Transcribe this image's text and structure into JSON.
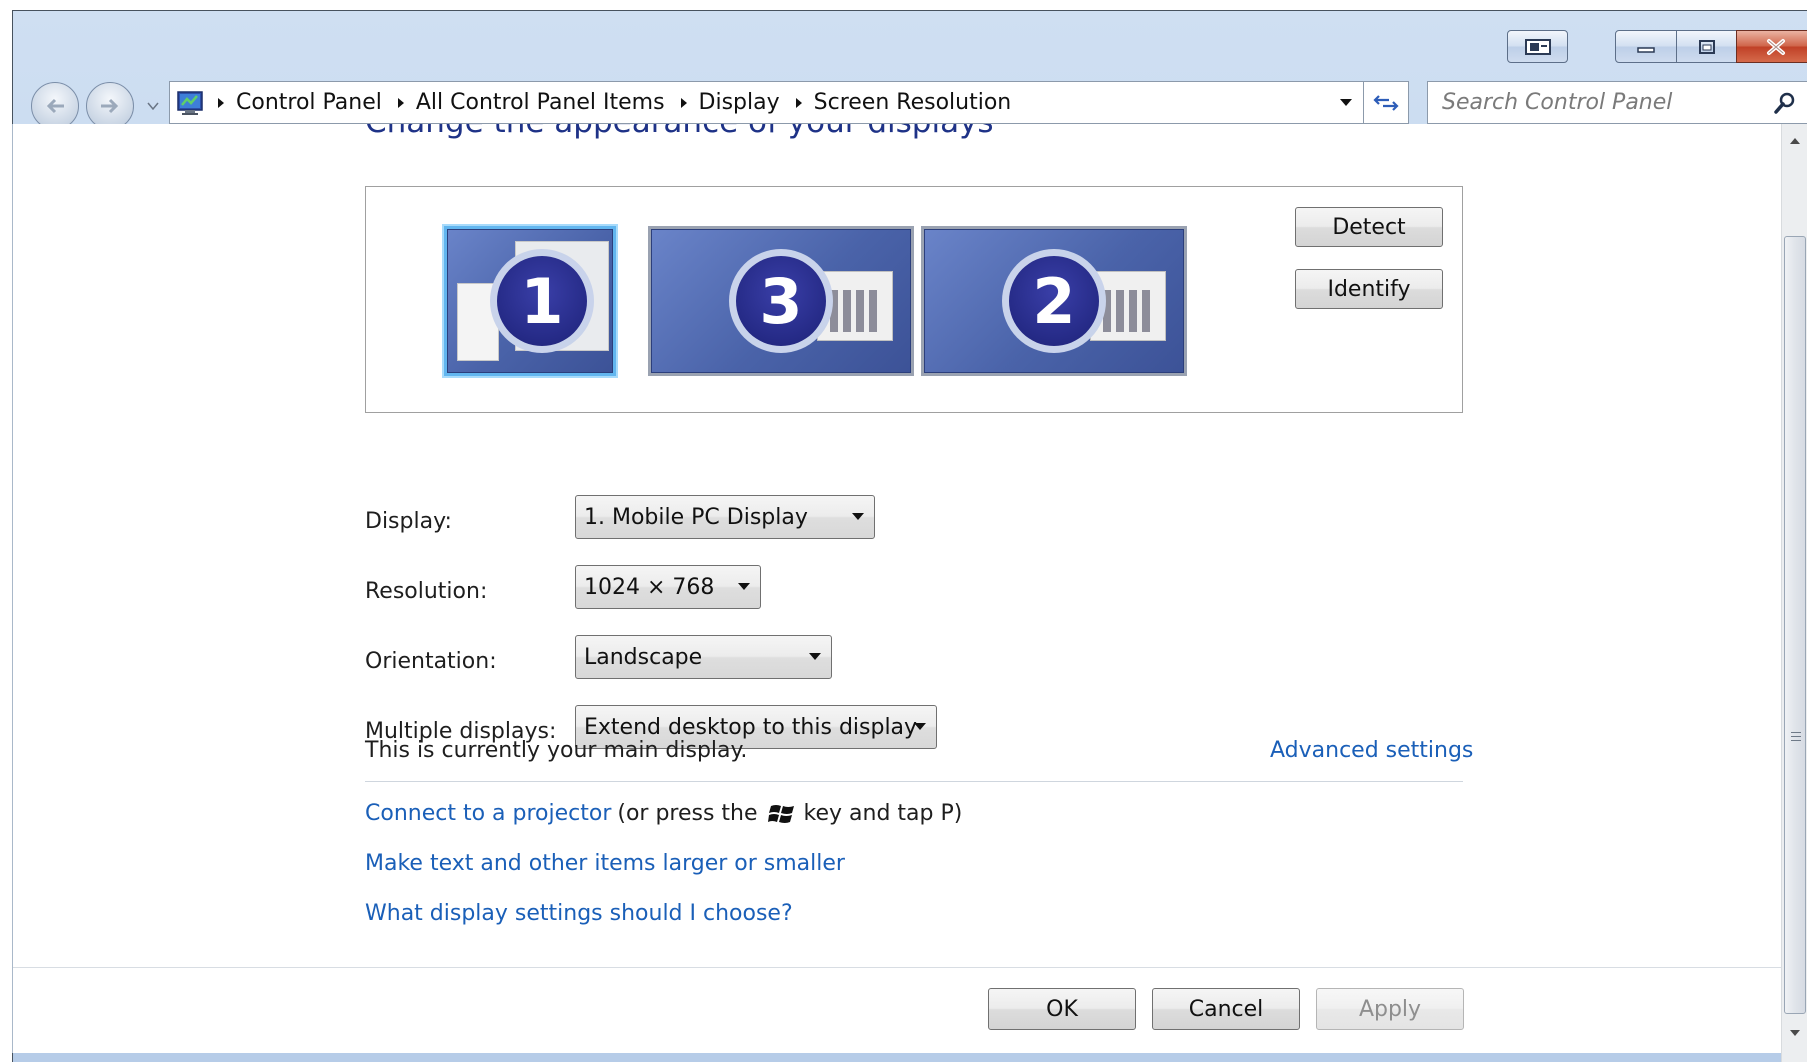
{
  "window": {
    "title": "Screen Resolution"
  },
  "address_bar": {
    "breadcrumbs": [
      "Control Panel",
      "All Control Panel Items",
      "Display",
      "Screen Resolution"
    ]
  },
  "search": {
    "placeholder": "Search Control Panel"
  },
  "content": {
    "heading": "Change the appearance of your displays",
    "monitors": [
      {
        "number": "1",
        "selected": true
      },
      {
        "number": "3",
        "selected": false
      },
      {
        "number": "2",
        "selected": false
      }
    ],
    "detect_label": "Detect",
    "identify_label": "Identify",
    "settings": {
      "display_label": "Display:",
      "display_value": "1. Mobile PC Display",
      "resolution_label": "Resolution:",
      "resolution_value": "1024 × 768",
      "orientation_label": "Orientation:",
      "orientation_value": "Landscape",
      "multiple_label": "Multiple displays:",
      "multiple_value": "Extend desktop to this display"
    },
    "main_display_text": "This is currently your main display.",
    "advanced_link": "Advanced settings",
    "projector_link": "Connect to a projector",
    "projector_pre": "(or press the",
    "projector_post": "key and tap P)",
    "text_size_link": "Make text and other items larger or smaller",
    "which_settings_link": "What display settings should I choose?"
  },
  "footer": {
    "ok_label": "OK",
    "cancel_label": "Cancel",
    "apply_label": "Apply"
  },
  "colors": {
    "link": "#1a5fb8",
    "heading": "#1e3287",
    "monitor_blue": "#4a63a9",
    "selected_border": "#62b6ef"
  },
  "icons": {
    "back": "back-arrow-icon",
    "forward": "forward-arrow-icon",
    "address": "control-panel-icon",
    "refresh": "refresh-icon",
    "search": "search-icon",
    "windows_key": "windows-logo-icon"
  }
}
